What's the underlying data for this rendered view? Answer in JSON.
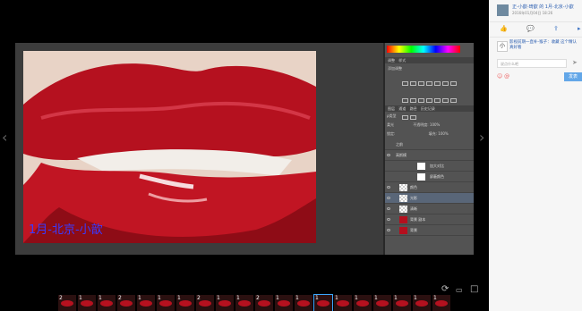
{
  "photo": {
    "watermark": "1月-北京-小歆"
  },
  "ps_panel": {
    "top_tabs": [
      "调整",
      "样式"
    ],
    "adjust_title": "添加调整",
    "layers_tabs": [
      "图层",
      "通道",
      "路径",
      "历史记录"
    ],
    "filter_label": "ρ类型",
    "blend_mode": "柔光",
    "opacity_label": "不透明度:",
    "opacity_value": "100%",
    "lock_label": "锁定:",
    "fill_label": "填充:",
    "fill_value": "100%",
    "layers": [
      {
        "name": "之前",
        "type": "group",
        "selected": false
      },
      {
        "name": "高斯模",
        "type": "group",
        "selected": false
      },
      {
        "name": "加大对比",
        "type": "adjust",
        "selected": false
      },
      {
        "name": "屏蔽颜色",
        "type": "adjust",
        "selected": false
      },
      {
        "name": "颜色",
        "type": "pixel",
        "selected": false
      },
      {
        "name": "光影",
        "type": "pixel",
        "selected": true
      },
      {
        "name": "清晰",
        "type": "pixel",
        "selected": false
      },
      {
        "name": "背景 副本",
        "type": "photo",
        "selected": false
      },
      {
        "name": "背景",
        "type": "photo",
        "selected": false
      }
    ]
  },
  "filmstrip": {
    "thumbnails": [
      "2",
      "1",
      "1",
      "2",
      "1",
      "1",
      "1",
      "2",
      "1",
      "1",
      "2",
      "1",
      "1",
      "1",
      "1",
      "1",
      "1",
      "1",
      "1",
      "1"
    ],
    "active_index": 13
  },
  "viewer_controls": {
    "rotate_icon": "rotate-icon",
    "original_size_icon": "original-size-icon",
    "fullscreen_icon": "fullscreen-icon"
  },
  "sidebar": {
    "author": "正-小歆-琦歆 的 1月-北京-小歆",
    "date": "2016年01月04日 18:26",
    "actions": {
      "like_icon": "thumbs-up-icon",
      "comment_icon": "comment-icon",
      "share_icon": "share-icon"
    },
    "comment_avatar": "小",
    "comment_text": "影视前期一直补-猴子：收藏 这个精认真好看",
    "input_placeholder": "说点什么吧",
    "submit_label": "发表"
  }
}
